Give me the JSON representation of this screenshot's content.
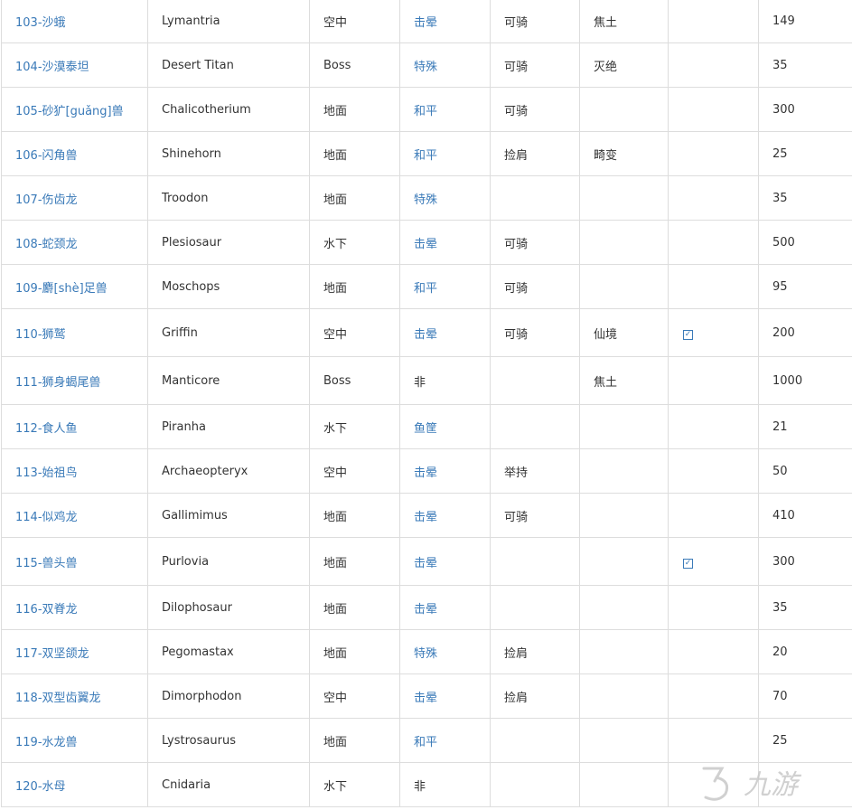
{
  "rows": [
    {
      "name": "103-沙蛾",
      "en": "Lymantria",
      "habitat": "空中",
      "tame": "击晕",
      "use": "可骑",
      "zone": "焦土",
      "check": false,
      "value": "149"
    },
    {
      "name": "104-沙漠泰坦",
      "en": "Desert Titan",
      "habitat": "Boss",
      "tame": "特殊",
      "use": "可骑",
      "zone": "灭绝",
      "check": false,
      "value": "35"
    },
    {
      "name": "105-砂犷[guǎng]兽",
      "en": "Chalicotherium",
      "habitat": "地面",
      "tame": "和平",
      "use": "可骑",
      "zone": "",
      "check": false,
      "value": "300"
    },
    {
      "name": "106-闪角兽",
      "en": "Shinehorn",
      "habitat": "地面",
      "tame": "和平",
      "use": "捡肩",
      "zone": "畸变",
      "check": false,
      "value": "25"
    },
    {
      "name": "107-伤齿龙",
      "en": "Troodon",
      "habitat": "地面",
      "tame": "特殊",
      "use": "",
      "zone": "",
      "check": false,
      "value": "35"
    },
    {
      "name": "108-蛇颈龙",
      "en": "Plesiosaur",
      "habitat": "水下",
      "tame": "击晕",
      "use": "可骑",
      "zone": "",
      "check": false,
      "value": "500"
    },
    {
      "name": "109-麝[shè]足兽",
      "en": "Moschops",
      "habitat": "地面",
      "tame": "和平",
      "use": "可骑",
      "zone": "",
      "check": false,
      "value": "95"
    },
    {
      "name": "110-狮鹫",
      "en": "Griffin",
      "habitat": "空中",
      "tame": "击晕",
      "use": "可骑",
      "zone": "仙境",
      "check": true,
      "value": "200"
    },
    {
      "name": "111-狮身蝎尾兽",
      "en": "Manticore",
      "habitat": "Boss",
      "tame": "非",
      "use": "",
      "zone": "焦土",
      "check": false,
      "value": "1000"
    },
    {
      "name": "112-食人鱼",
      "en": "Piranha",
      "habitat": "水下",
      "tame": "鱼筐",
      "use": "",
      "zone": "",
      "check": false,
      "value": "21"
    },
    {
      "name": "113-始祖鸟",
      "en": "Archaeopteryx",
      "habitat": "空中",
      "tame": "击晕",
      "use": "举持",
      "zone": "",
      "check": false,
      "value": "50"
    },
    {
      "name": "114-似鸡龙",
      "en": "Gallimimus",
      "habitat": "地面",
      "tame": "击晕",
      "use": "可骑",
      "zone": "",
      "check": false,
      "value": "410"
    },
    {
      "name": "115-兽头兽",
      "en": "Purlovia",
      "habitat": "地面",
      "tame": "击晕",
      "use": "",
      "zone": "",
      "check": true,
      "value": "300"
    },
    {
      "name": "116-双脊龙",
      "en": "Dilophosaur",
      "habitat": "地面",
      "tame": "击晕",
      "use": "",
      "zone": "",
      "check": false,
      "value": "35"
    },
    {
      "name": "117-双坚颌龙",
      "en": "Pegomastax",
      "habitat": "地面",
      "tame": "特殊",
      "use": "捡肩",
      "zone": "",
      "check": false,
      "value": "20"
    },
    {
      "name": "118-双型齿翼龙",
      "en": "Dimorphodon",
      "habitat": "空中",
      "tame": "击晕",
      "use": "捡肩",
      "zone": "",
      "check": false,
      "value": "70"
    },
    {
      "name": "119-水龙兽",
      "en": "Lystrosaurus",
      "habitat": "地面",
      "tame": "和平",
      "use": "",
      "zone": "",
      "check": false,
      "value": "25"
    },
    {
      "name": "120-水母",
      "en": "Cnidaria",
      "habitat": "水下",
      "tame": "非",
      "use": "",
      "zone": "",
      "check": false,
      "value": ""
    }
  ],
  "check_glyph": "✓",
  "watermark": {
    "text": "九游",
    "color": "#c8c8c8"
  }
}
